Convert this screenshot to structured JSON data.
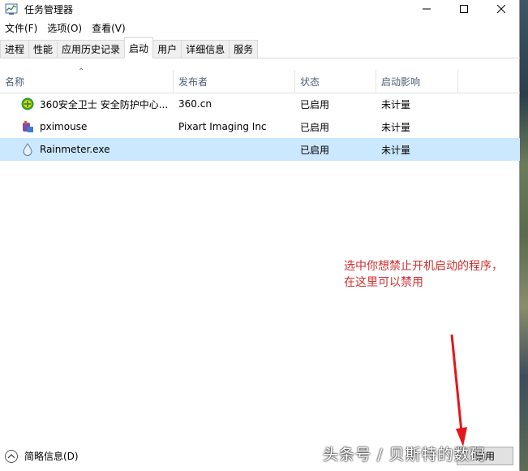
{
  "window": {
    "title": "任务管理器",
    "controls": [
      "minimize-icon",
      "maximize-icon",
      "close-icon"
    ]
  },
  "menu": [
    "文件(F)",
    "选项(O)",
    "查看(V)"
  ],
  "tabs": [
    {
      "label": "进程",
      "active": false
    },
    {
      "label": "性能",
      "active": false
    },
    {
      "label": "应用历史记录",
      "active": false
    },
    {
      "label": "启动",
      "active": true
    },
    {
      "label": "用户",
      "active": false
    },
    {
      "label": "详细信息",
      "active": false
    },
    {
      "label": "服务",
      "active": false
    }
  ],
  "columns": [
    "名称",
    "发布者",
    "状态",
    "启动影响"
  ],
  "rows": [
    {
      "name": "360安全卫士 安全防护中心...",
      "publisher": "360.cn",
      "status": "已启用",
      "impact": "未计量",
      "icon": "shield-360-icon",
      "selected": false
    },
    {
      "name": "pximouse",
      "publisher": "Pixart Imaging Inc",
      "status": "已启用",
      "impact": "未计量",
      "icon": "mouse-app-icon",
      "selected": false
    },
    {
      "name": "Rainmeter.exe",
      "publisher": "",
      "status": "已启用",
      "impact": "未计量",
      "icon": "droplet-icon",
      "selected": true
    }
  ],
  "annotation": {
    "line1": "选中你想禁止开机启动的程序，",
    "line2": "在这里可以禁用",
    "color": "#d12f2f"
  },
  "footer": {
    "brief_label": "简略信息(D)",
    "disable_label": "禁用"
  },
  "watermark": "头条号 / 贝斯特的数码",
  "colors": {
    "selection": "#cce8ff",
    "header_text": "#4c607a",
    "arrow": "#e5161b"
  }
}
